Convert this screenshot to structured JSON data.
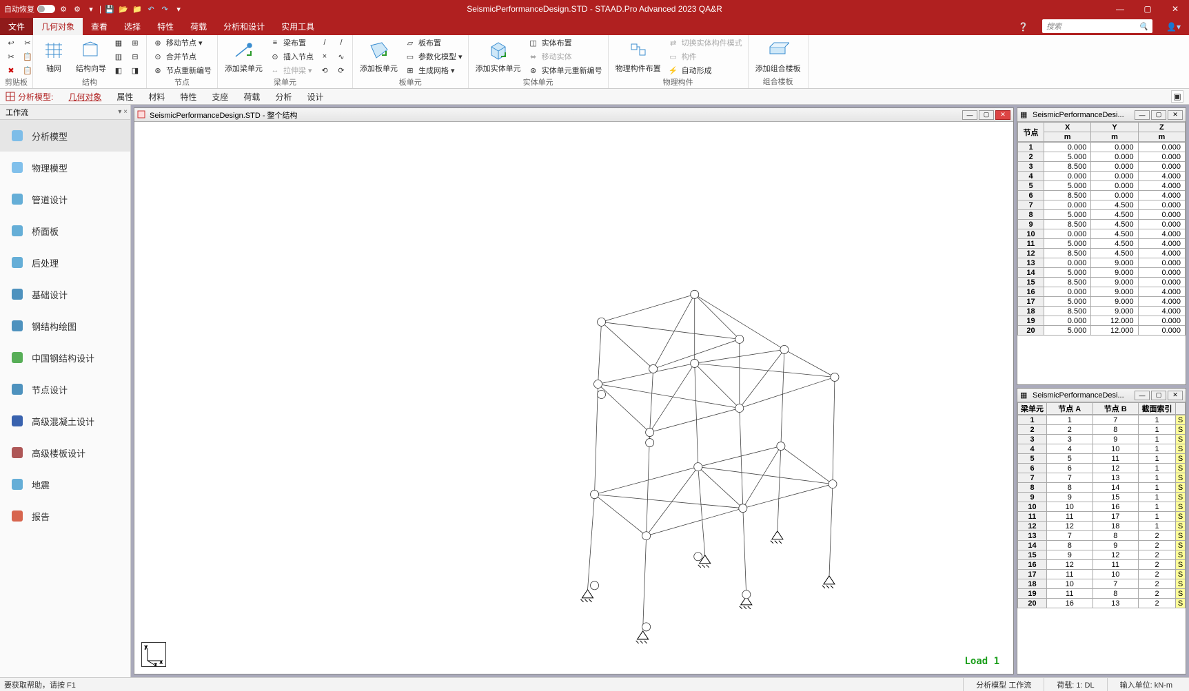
{
  "title": {
    "autorecover": "自动恢复",
    "center": "SeismicPerformanceDesign.STD - STAAD.Pro Advanced 2023 QA&R"
  },
  "menu": {
    "file": "文件",
    "geom": "几何对象",
    "view": "查看",
    "select": "选择",
    "props": "特性",
    "loads": "荷载",
    "analysis": "分析和设计",
    "utils": "实用工具",
    "search_ph": "搜索"
  },
  "ribbon_groups": {
    "clipboard": "剪贴板",
    "structure": "结构",
    "node": "节点",
    "beam": "梁单元",
    "plate": "板单元",
    "solid": "实体单元",
    "physical": "物理构件",
    "composite": "组合楼板"
  },
  "ribbon": {
    "axis": "轴网",
    "orient": "结构向导",
    "move": "移动节点 ▾",
    "merge": "合并节点",
    "renumN": "节点重新编号",
    "addBeam": "添加梁单元",
    "beamLayout": "梁布置",
    "insertN": "插入节点",
    "stretch": "拉伸梁 ▾",
    "addPlate": "添加板单元",
    "plateLayout": "板布置",
    "param": "参数化模型 ▾",
    "mesh": "生成网格 ▾",
    "addSolid": "添加实体单元",
    "solidLayout": "实体布置",
    "moveSolid": "移动实体",
    "renumS": "实体单元重新编号",
    "physLayout": "物理构件布置",
    "switchPhys": "切换实体构件模式",
    "member": "构件",
    "autoForm": "自动形成",
    "addComposite": "添加组合楼板"
  },
  "subribbon": {
    "label": "分析模型:",
    "items": [
      "几何对象",
      "属性",
      "材料",
      "特性",
      "支座",
      "荷载",
      "分析",
      "设计"
    ]
  },
  "workflow": {
    "header": "工作流",
    "items": [
      {
        "k": "analysis",
        "label": "分析模型",
        "color": "#6bb5e8"
      },
      {
        "k": "physical",
        "label": "物理模型",
        "color": "#6bb5e8"
      },
      {
        "k": "pipe",
        "label": "管道设计",
        "color": "#4aa0d0"
      },
      {
        "k": "bridge",
        "label": "桥面板",
        "color": "#4aa0d0"
      },
      {
        "k": "post",
        "label": "后处理",
        "color": "#4aa0d0"
      },
      {
        "k": "found",
        "label": "基础设计",
        "color": "#2f7fb3"
      },
      {
        "k": "steel",
        "label": "钢结构绘图",
        "color": "#2f7fb3"
      },
      {
        "k": "cnsteel",
        "label": "中国钢结构设计",
        "color": "#3aa03a"
      },
      {
        "k": "conn",
        "label": "节点设计",
        "color": "#2f7fb3"
      },
      {
        "k": "concrete",
        "label": "高级混凝土设计",
        "color": "#1646a0"
      },
      {
        "k": "slab",
        "label": "高级楼板设计",
        "color": "#a03a3a"
      },
      {
        "k": "seismic",
        "label": "地震",
        "color": "#4aa0d0"
      },
      {
        "k": "report",
        "label": "报告",
        "color": "#d04a2f"
      }
    ]
  },
  "mdi_main_title": "SeismicPerformanceDesign.STD - 整个结构",
  "mdi_right_title": "SeismicPerformanceDesi...",
  "load_label": "Load 1",
  "nodes_table": {
    "headers": {
      "node": "节点",
      "x": "X",
      "y": "Y",
      "z": "Z",
      "unit": "m"
    },
    "rows": [
      [
        1,
        0.0,
        0.0,
        0.0
      ],
      [
        2,
        5.0,
        0.0,
        0.0
      ],
      [
        3,
        8.5,
        0.0,
        0.0
      ],
      [
        4,
        0.0,
        0.0,
        4.0
      ],
      [
        5,
        5.0,
        0.0,
        4.0
      ],
      [
        6,
        8.5,
        0.0,
        4.0
      ],
      [
        7,
        0.0,
        4.5,
        0.0
      ],
      [
        8,
        5.0,
        4.5,
        0.0
      ],
      [
        9,
        8.5,
        4.5,
        0.0
      ],
      [
        10,
        0.0,
        4.5,
        4.0
      ],
      [
        11,
        5.0,
        4.5,
        4.0
      ],
      [
        12,
        8.5,
        4.5,
        4.0
      ],
      [
        13,
        0.0,
        9.0,
        0.0
      ],
      [
        14,
        5.0,
        9.0,
        0.0
      ],
      [
        15,
        8.5,
        9.0,
        0.0
      ],
      [
        16,
        0.0,
        9.0,
        4.0
      ],
      [
        17,
        5.0,
        9.0,
        4.0
      ],
      [
        18,
        8.5,
        9.0,
        4.0
      ],
      [
        19,
        0.0,
        12.0,
        0.0
      ],
      [
        20,
        5.0,
        12.0,
        0.0
      ]
    ]
  },
  "beams_table": {
    "headers": {
      "beam": "梁单元",
      "na": "节点 A",
      "nb": "节点 B",
      "sec": "截面索引"
    },
    "rows": [
      [
        1,
        1,
        7,
        1,
        "S"
      ],
      [
        2,
        2,
        8,
        1,
        "S"
      ],
      [
        3,
        3,
        9,
        1,
        "S"
      ],
      [
        4,
        4,
        10,
        1,
        "S"
      ],
      [
        5,
        5,
        11,
        1,
        "S"
      ],
      [
        6,
        6,
        12,
        1,
        "S"
      ],
      [
        7,
        7,
        13,
        1,
        "S"
      ],
      [
        8,
        8,
        14,
        1,
        "S"
      ],
      [
        9,
        9,
        15,
        1,
        "S"
      ],
      [
        10,
        10,
        16,
        1,
        "S"
      ],
      [
        11,
        11,
        17,
        1,
        "S"
      ],
      [
        12,
        12,
        18,
        1,
        "S"
      ],
      [
        13,
        7,
        8,
        2,
        "S"
      ],
      [
        14,
        8,
        9,
        2,
        "S"
      ],
      [
        15,
        9,
        12,
        2,
        "S"
      ],
      [
        16,
        12,
        11,
        2,
        "S"
      ],
      [
        17,
        11,
        10,
        2,
        "S"
      ],
      [
        18,
        10,
        7,
        2,
        "S"
      ],
      [
        19,
        11,
        8,
        2,
        "S"
      ],
      [
        20,
        16,
        13,
        2,
        "S"
      ]
    ]
  },
  "status": {
    "help": "要获取帮助，请按 F1",
    "mode": "分析模型 工作流",
    "load": "荷载: 1: DL",
    "units": "输入单位: kN-m"
  }
}
